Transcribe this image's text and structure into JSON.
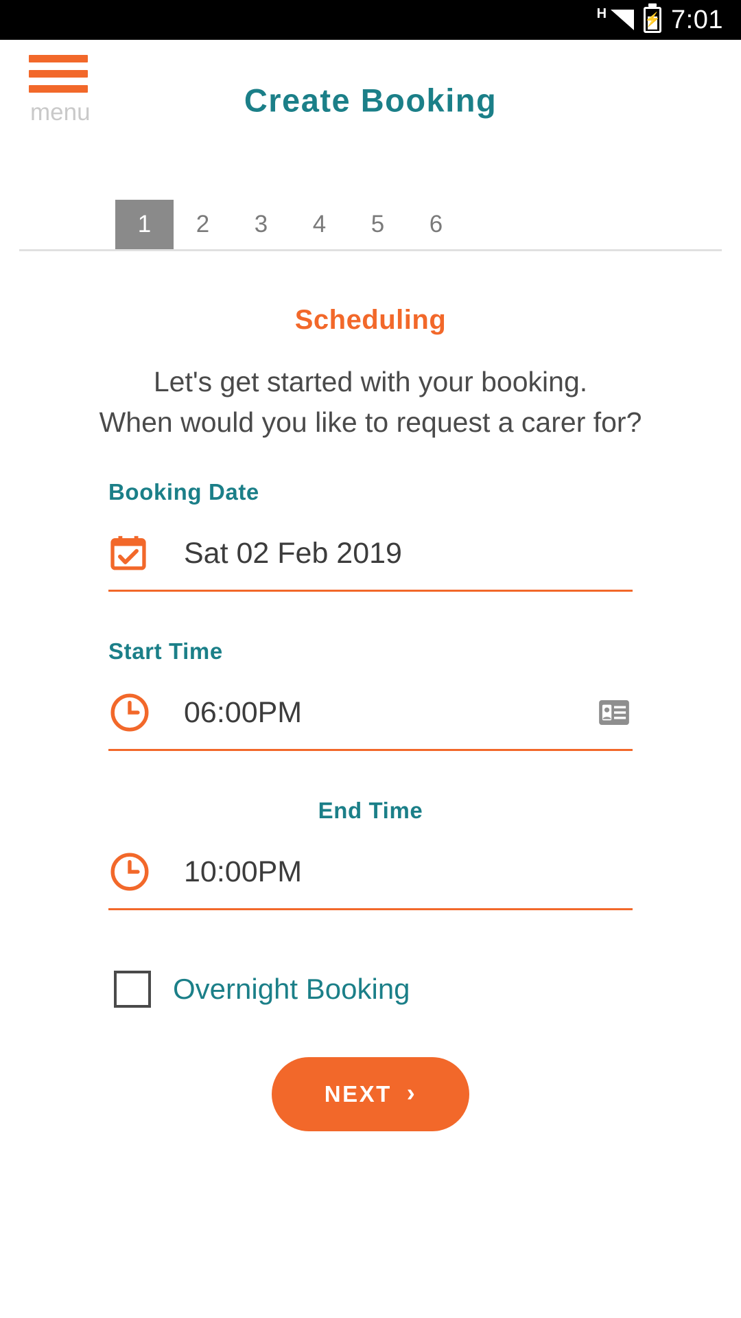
{
  "status_bar": {
    "network_type": "H",
    "signal_icon": "signal-bars-icon",
    "battery_icon": "battery-charging-icon",
    "time": "7:01"
  },
  "app_bar": {
    "menu_icon": "hamburger-menu-icon",
    "menu_label": "menu",
    "title": "Create Booking"
  },
  "stepper": {
    "active_index": 0,
    "steps": [
      {
        "label": "1"
      },
      {
        "label": "2"
      },
      {
        "label": "3"
      },
      {
        "label": "4"
      },
      {
        "label": "5"
      },
      {
        "label": "6"
      }
    ]
  },
  "content": {
    "section_title": "Scheduling",
    "intro_line1": "Let's get started with your booking.",
    "intro_line2": "When would you like to request a carer for?",
    "booking_date": {
      "label": "Booking Date",
      "icon": "calendar-check-icon",
      "value": "Sat 02 Feb 2019"
    },
    "start_time": {
      "label": "Start Time",
      "icon": "clock-icon",
      "value": "06:00PM",
      "trailing_icon": "contact-card-icon"
    },
    "end_time": {
      "label": "End Time",
      "icon": "clock-icon",
      "value": "10:00PM"
    },
    "overnight": {
      "label": "Overnight Booking",
      "checked": false
    },
    "next_button": {
      "label": "NEXT",
      "chevron_icon": "chevron-right-icon"
    }
  },
  "colors": {
    "teal": "#1b7f88",
    "orange": "#f2682a",
    "grey_active_tab": "#8a8a8a",
    "text_dark": "#3c3c3c"
  }
}
